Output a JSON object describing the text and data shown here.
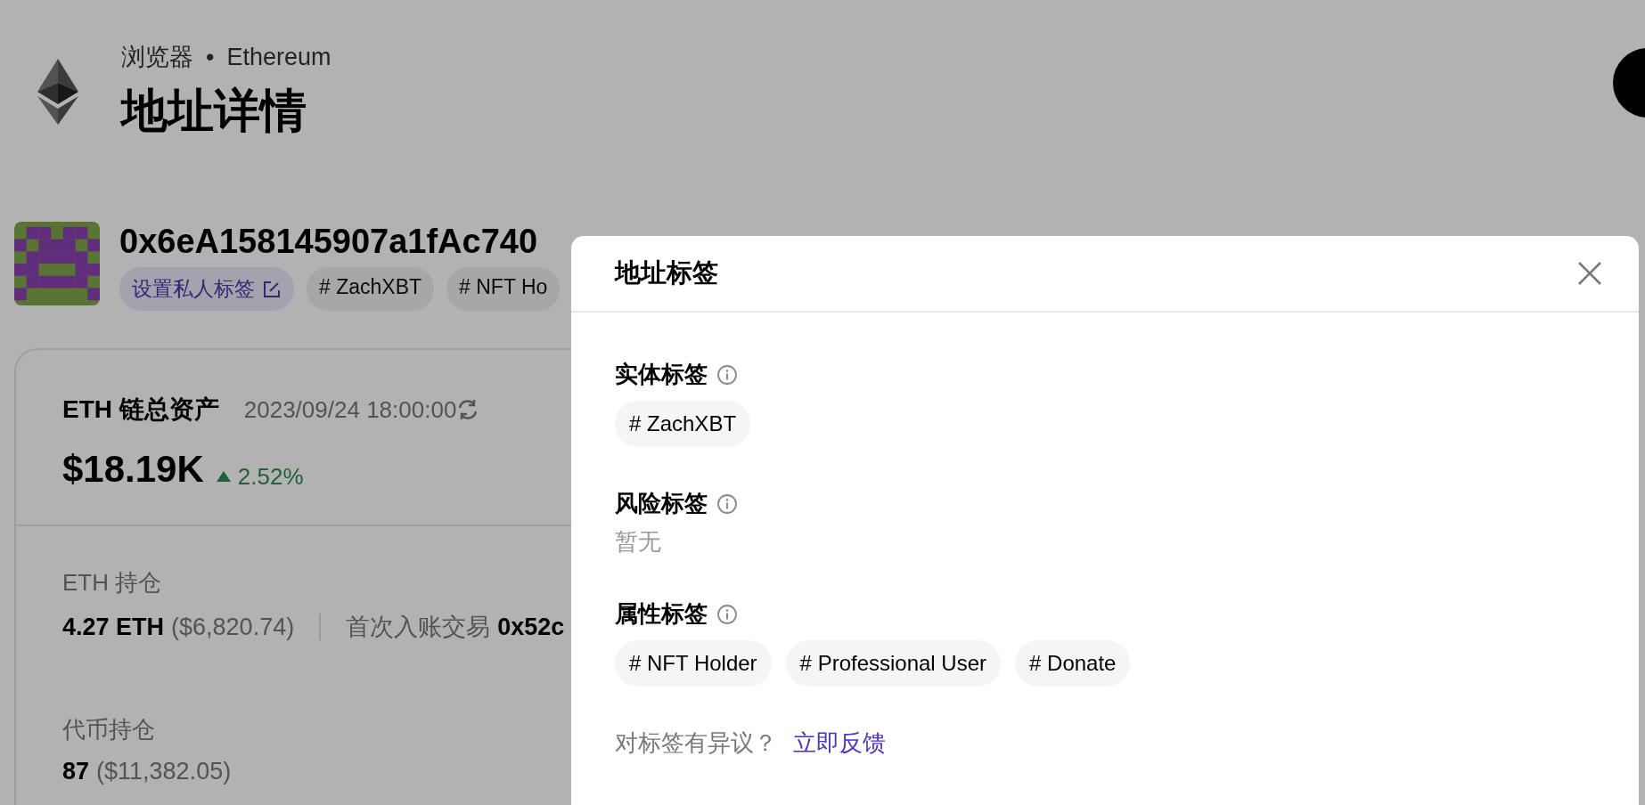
{
  "breadcrumb": {
    "section": "浏览器",
    "separator": "•",
    "network": "Ethereum"
  },
  "page_title": "地址详情",
  "address": {
    "value": "0x6eA158145907a1fAc740",
    "tags": [
      {
        "kind": "private",
        "label": "设置私人标签"
      },
      {
        "kind": "tag",
        "label": "# ZachXBT"
      },
      {
        "kind": "tag",
        "label": "# NFT Ho"
      }
    ]
  },
  "assets_card": {
    "title": "ETH 链总资产",
    "updated": "2023/09/24 18:00:00",
    "total": "$18.19K",
    "change": "2.52%",
    "rising": true,
    "eth_holding": {
      "label": "ETH 持仓",
      "amount": "4.27 ETH",
      "value": "($6,820.74)",
      "first_tx_label": "首次入账交易",
      "first_tx": "0x52c"
    },
    "token_holding": {
      "label": "代币持仓",
      "amount": "87",
      "value": "($11,382.05)"
    }
  },
  "modal": {
    "title": "地址标签",
    "sections": [
      {
        "title": "实体标签",
        "tags": [
          "# ZachXBT"
        ]
      },
      {
        "title": "风险标签",
        "empty_text": "暂无"
      },
      {
        "title": "属性标签",
        "tags": [
          "# NFT Holder",
          "# Professional User",
          "# Donate"
        ]
      }
    ],
    "footer": {
      "text": "对标签有异议？",
      "link": "立即反馈"
    }
  }
}
